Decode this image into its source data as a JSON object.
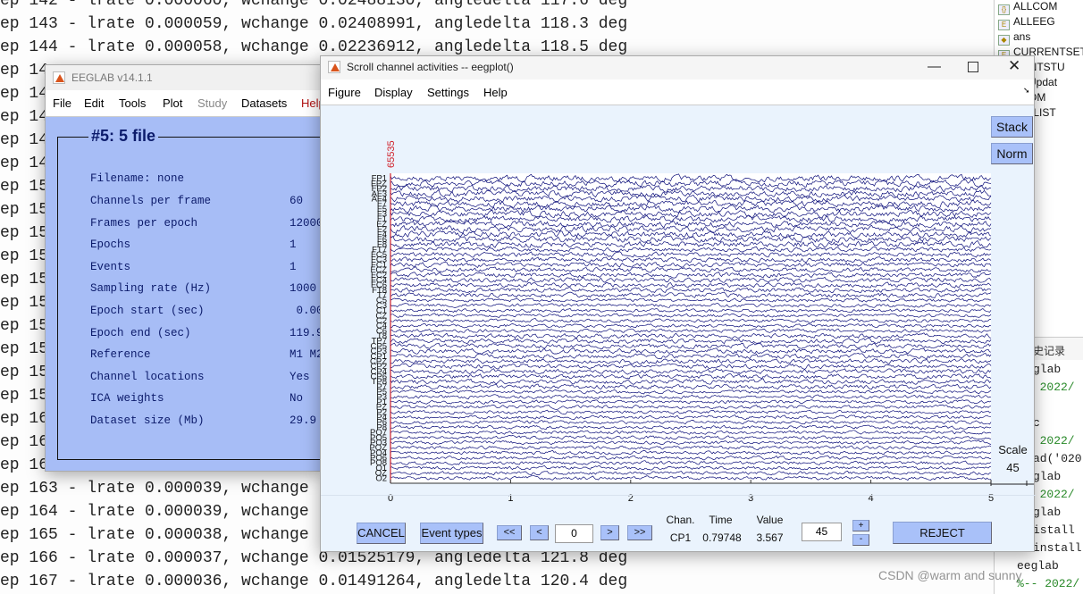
{
  "console": {
    "lines": [
      "ep 142 - lrate 0.000060, wchange 0.02488130, angledelta 117.6 deg",
      "ep 143 - lrate 0.000059, wchange 0.02408991, angledelta 118.3 deg",
      "ep 144 - lrate 0.000058, wchange 0.02236912, angledelta 118.5 deg",
      "ep 14",
      "ep 14",
      "ep 14",
      "ep 14",
      "ep 14",
      "ep 15",
      "ep 15",
      "ep 15",
      "ep 15",
      "ep 15",
      "ep 15",
      "ep 15",
      "ep 15",
      "ep 15",
      "ep 15",
      "ep 16",
      "ep 16",
      "ep 16",
      "ep 163 - lrate 0.000039, wchange",
      "ep 164 - lrate 0.000039, wchange",
      "ep 165 - lrate 0.000038, wchange",
      "ep 166 - lrate 0.000037, wchange 0.01525179, angledelta 121.8 deg",
      "ep 167 - lrate 0.000036, wchange 0.01491264, angledelta 120.4 deg"
    ]
  },
  "workspace": {
    "items": [
      "ALLCOM",
      "ALLEEG",
      "ans",
      "CURRENTSET",
      "RENTSTU",
      "labUpdat",
      "TCOM",
      "GINLIST",
      "DY"
    ]
  },
  "history": {
    "title": "史记录",
    "lines": [
      {
        "t": "glab",
        "g": false
      },
      {
        "t": "- 2022/",
        "g": true
      },
      {
        "t": "c",
        "g": false
      },
      {
        "t": "- 2022/",
        "g": true
      },
      {
        "t": "ad('020",
        "g": false
      },
      {
        "t": "glab",
        "g": false
      },
      {
        "t": "- 2022/",
        "g": true
      },
      {
        "t": "glab",
        "g": false
      },
      {
        "t": "istall",
        "g": false
      },
      {
        "t": "install",
        "g": false
      },
      {
        "t": "eeglab",
        "g": false
      },
      {
        "t": "%-- 2022/",
        "g": true
      }
    ]
  },
  "eeglab": {
    "title": "EEGLAB v14.1.1",
    "menu": [
      "File",
      "Edit",
      "Tools",
      "Plot",
      "Study",
      "Datasets",
      "Help"
    ],
    "dataset_title": "#5: 5 file",
    "filename": "Filename: none",
    "rows": [
      {
        "k": "Channels per frame",
        "v": "60"
      },
      {
        "k": "Frames per epoch",
        "v": "12000"
      },
      {
        "k": "Epochs",
        "v": "1"
      },
      {
        "k": "Events",
        "v": "1"
      },
      {
        "k": "Sampling rate (Hz)",
        "v": "1000"
      },
      {
        "k": "Epoch start (sec)",
        "v": " 0.00"
      },
      {
        "k": "Epoch end (sec)",
        "v": "119.9"
      },
      {
        "k": "Reference",
        "v": "M1 M2"
      },
      {
        "k": "Channel locations",
        "v": "Yes"
      },
      {
        "k": "ICA weights",
        "v": "No"
      },
      {
        "k": "Dataset size (Mb)",
        "v": "29.9"
      }
    ]
  },
  "eegplot": {
    "title": "Scroll channel activities -- eegplot()",
    "menu": [
      "Figure",
      "Display",
      "Settings",
      "Help"
    ],
    "stack": "Stack",
    "norm": "Norm",
    "event_label": "65535",
    "scale_label": "Scale",
    "scale_value": "45",
    "cancel": "CANCEL",
    "event_types": "Event types",
    "nav": [
      "<<",
      "<",
      ">",
      ">>"
    ],
    "time_input": "0",
    "chan_header": "Chan.",
    "time_header": "Time",
    "value_header": "Value",
    "chan": "CP1",
    "time": "0.79748",
    "value": "3.567",
    "scale_input": "45",
    "plus": "+",
    "minus": "-",
    "reject": "REJECT",
    "trace_color": "#0b0e7a",
    "event_color": "#d0202a"
  },
  "chart_data": {
    "type": "line",
    "xlim": [
      0,
      5
    ],
    "xticks": [
      "0",
      "1",
      "2",
      "3",
      "4",
      "5"
    ],
    "channels": [
      "FP1",
      "FPZ",
      "FP2",
      "AF3",
      "AF4",
      "F7",
      "F5",
      "F3",
      "F1",
      "FZ",
      "F2",
      "F4",
      "F6",
      "F8",
      "FT7",
      "FC5",
      "FC3",
      "FC1",
      "FCZ",
      "FC2",
      "FC4",
      "FC6",
      "FT8",
      "T7",
      "C5",
      "C3",
      "C1",
      "CZ",
      "C2",
      "C4",
      "C6",
      "T8",
      "TP7",
      "CP5",
      "CP3",
      "CP1",
      "CPZ",
      "CP2",
      "CP4",
      "CP6",
      "TP8",
      "P7",
      "P5",
      "P3",
      "P1",
      "PZ",
      "P2",
      "P4",
      "P6",
      "P8",
      "PO7",
      "PO5",
      "PO3",
      "POZ",
      "PO4",
      "PO6",
      "PO8",
      "O1",
      "OZ",
      "O2"
    ]
  },
  "watermark": "CSDN @warm and sunny"
}
